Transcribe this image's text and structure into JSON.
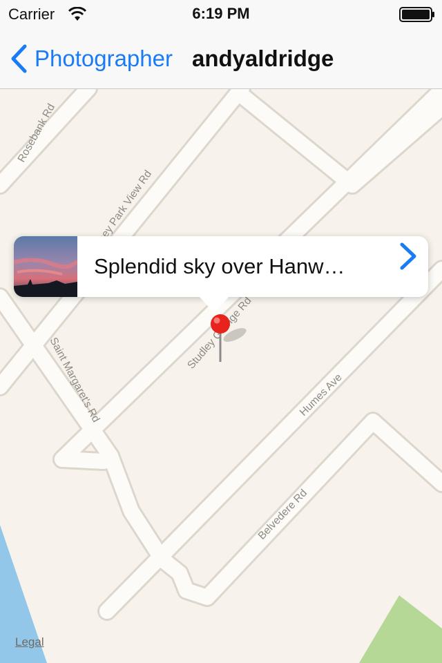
{
  "status_bar": {
    "carrier": "Carrier",
    "time": "6:19 PM"
  },
  "nav": {
    "back_label": "Photographer",
    "title": "andyaldridge"
  },
  "map": {
    "roads": [
      "Rosebank Rd",
      "Haney Park View Rd",
      "Studley Grange Rd",
      "Saint Margaret's Rd",
      "Humes Ave",
      "Belvedere Rd"
    ],
    "legal": "Legal"
  },
  "callout": {
    "title": "Splendid sky over Hanw…"
  },
  "icons": {
    "back": "chevron-left-icon",
    "disclosure": "chevron-right-icon",
    "pin": "map-pin-icon",
    "wifi": "wifi-icon",
    "battery": "battery-icon"
  },
  "colors": {
    "accent": "#1a7cf5",
    "pin": "#e8221c",
    "water": "#92c7ea",
    "park": "#b5d896",
    "map_bg": "#f7f3ec"
  }
}
